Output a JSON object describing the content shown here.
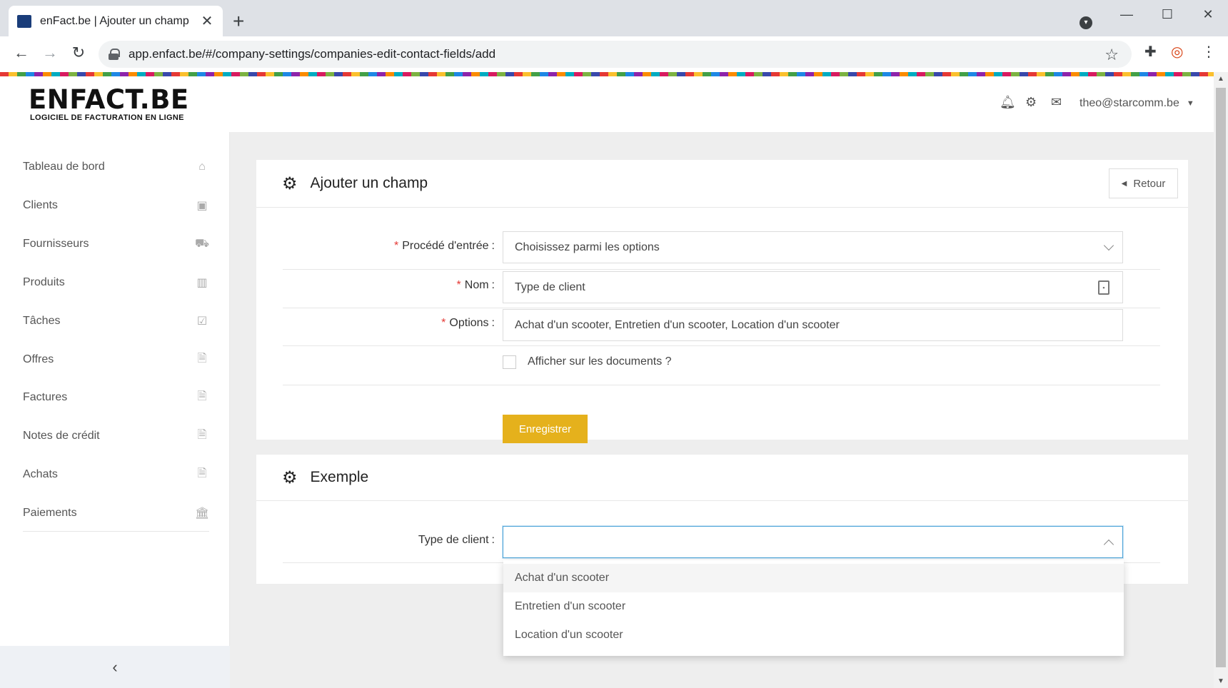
{
  "browser": {
    "tab_title": "enFact.be | Ajouter un champ",
    "url": "app.enfact.be/#/company-settings/companies-edit-contact-fields/add"
  },
  "header": {
    "logo_main": "ENFACT.BE",
    "logo_sub": "LOGICIEL DE FACTURATION EN LIGNE",
    "user_email": "theo@starcomm.be",
    "icons": [
      "bell-icon",
      "cogs-icon",
      "envelope-icon"
    ]
  },
  "sidebar": {
    "items": [
      {
        "label": "Tableau de bord",
        "icon": "home-icon"
      },
      {
        "label": "Clients",
        "icon": "address-book-icon"
      },
      {
        "label": "Fournisseurs",
        "icon": "truck-icon"
      },
      {
        "label": "Produits",
        "icon": "barcode-icon"
      },
      {
        "label": "Tâches",
        "icon": "calendar-check-icon"
      },
      {
        "label": "Offres",
        "icon": "file-pdf-icon"
      },
      {
        "label": "Factures",
        "icon": "file-pdf-icon"
      },
      {
        "label": "Notes de crédit",
        "icon": "file-pdf-icon"
      },
      {
        "label": "Achats",
        "icon": "file-pdf-icon"
      },
      {
        "label": "Paiements",
        "icon": "bank-icon"
      }
    ]
  },
  "add_card": {
    "title": "Ajouter un champ",
    "back_label": "Retour",
    "fields": {
      "entry_method_label": "Procédé d'entrée",
      "entry_method_placeholder": "Choisissez parmi les options",
      "name_label": "Nom",
      "name_value": "Type de client",
      "options_label": "Options",
      "options_value": "Achat d'un scooter, Entretien d'un scooter, Location d'un scooter",
      "show_on_docs_label": "Afficher sur les documents ?",
      "show_on_docs_checked": false
    },
    "save_label": "Enregistrer"
  },
  "example_card": {
    "title": "Exemple",
    "field_label": "Type de client",
    "field_value": "",
    "dropdown_options": [
      "Achat d'un scooter",
      "Entretien d'un scooter",
      "Location d'un scooter"
    ]
  },
  "colors": {
    "primary_button": "#e5b11c",
    "required_marker": "#e53935",
    "focus_border": "#4aa3d8"
  }
}
